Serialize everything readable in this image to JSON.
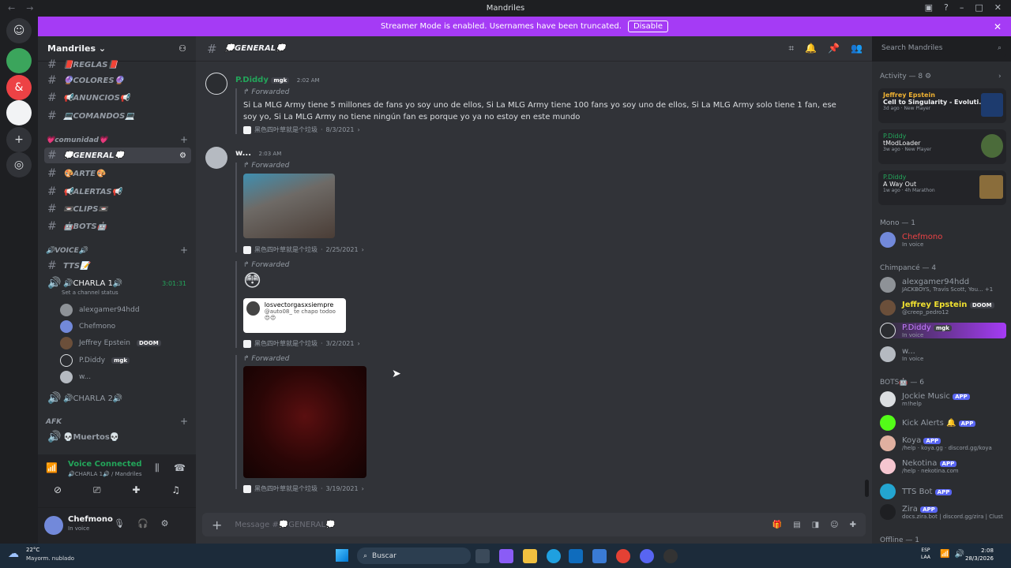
{
  "window": {
    "title": "Mandriles"
  },
  "banner": {
    "text": "Streamer Mode is enabled. Usernames have been truncated.",
    "button": "Disable"
  },
  "server": {
    "name": "Mandriles"
  },
  "channels": [
    {
      "name": "📕REGLAS📕"
    },
    {
      "name": "🔮COLORES🔮"
    },
    {
      "name": "📢ANUNCIOS📢"
    },
    {
      "name": "💻COMANDOS💻"
    }
  ],
  "cat_comunidad": "💗comunidad💗",
  "channels2": [
    {
      "name": "💭GENERAL💭"
    },
    {
      "name": "🎨ARTE🎨"
    },
    {
      "name": "📢ALERTAS📢"
    },
    {
      "name": "📼CLIPS📼"
    },
    {
      "name": "🤖BOTS🤖"
    }
  ],
  "cat_voice": "🔊VOICE🔊",
  "tts": "TTS📝",
  "charla1": {
    "name": "🔊CHARLA 1🔊",
    "timer": "3:01:31",
    "status": "Set a channel status"
  },
  "voice_members": [
    {
      "name": "alexgamer94hdd"
    },
    {
      "name": "Chefmono"
    },
    {
      "name": "Jeffrey Epstein",
      "tag": "DOOM"
    },
    {
      "name": "P.Diddy",
      "tag": "mgk"
    },
    {
      "name": "w..."
    }
  ],
  "charla2": "🔊CHARLA 2🔊",
  "cat_afk": "AFK",
  "muertos": "💀Muertos💀",
  "voice_panel": {
    "status": "Voice Connected",
    "where": "🔊CHARLA 1🔊 / Mandriles"
  },
  "user_panel": {
    "name": "Chefmono",
    "status": "In voice"
  },
  "chat": {
    "channel": "💭GENERAL💭",
    "search_placeholder": "Search Mandriles",
    "composer_placeholder": "Message #💭GENERAL💭",
    "forwarded": "Forwarded",
    "source": "黑色四叶草就是个垃圾",
    "messages": [
      {
        "author": "P.Diddy",
        "tag": "mgk",
        "time": "2:02 AM",
        "text": "Si La MLG Army tiene 5 millones de fans yo soy uno de ellos, Si La MLG Army tiene 100 fans yo soy uno de ellos, Si La MLG Army solo tiene 1 fan, ese soy yo, Si La MLG Army no tiene ningún fan es porque yo ya no estoy en este mundo",
        "date": "8/3/2021"
      },
      {
        "author": "w...",
        "time": "2:03 AM",
        "date1": "2/25/2021",
        "date2": "3/2/2021",
        "date3": "3/19/2021",
        "embed_user": "losvectorgasxsiempre",
        "embed_text": "@auto08_ te chapo todoo 😍😍"
      }
    ]
  },
  "activity": {
    "title": "Activity — 8",
    "items": [
      {
        "user": "Jeffrey Epstein",
        "game": "Cell to Singularity - Evoluti...",
        "meta": "3d ago",
        "badge": "New Player"
      },
      {
        "user": "P.Diddy",
        "game": "tModLoader",
        "meta": "3w ago",
        "badge": "New Player"
      },
      {
        "user": "P.Diddy",
        "game": "A Way Out",
        "meta": "1w ago",
        "badge": "4h Marathon"
      }
    ]
  },
  "members": {
    "mono_header": "Mono — 1",
    "mono": [
      {
        "name": "Chefmono",
        "sub": "In voice"
      }
    ],
    "chimp_header": "Chimpancé — 4",
    "chimp": [
      {
        "name": "alexgamer94hdd",
        "sub": "JACKBOYS, Travis Scott, You... +1"
      },
      {
        "name": "Jeffrey Epstein",
        "tag": "DOOM",
        "sub": "@creep_pedro12"
      },
      {
        "name": "P.Diddy",
        "tag": "mgk",
        "sub": "In voice"
      },
      {
        "name": "w...",
        "sub": "In voice"
      }
    ],
    "bots_header": "BOTS🤖 — 6",
    "bots": [
      {
        "name": "Jockie Music",
        "sub": "m!help"
      },
      {
        "name": "Kick Alerts 🔔",
        "sub": ""
      },
      {
        "name": "Koya",
        "sub": "/help · koya.gg · discord.gg/koya"
      },
      {
        "name": "Nekotina",
        "sub": "/help · nekotina.com"
      },
      {
        "name": "TTS Bot",
        "sub": ""
      },
      {
        "name": "Zira",
        "sub": "docs.zira.bot | discord.gg/zira | Clust"
      }
    ],
    "offline_header": "Offline — 1",
    "app_tag": "APP"
  },
  "taskbar": {
    "weather_temp": "22°C",
    "weather_text": "Mayorm. nublado",
    "search": "Buscar",
    "lang": "ESP",
    "region": "LAA",
    "time": "2:08",
    "date": "28/3/2026"
  }
}
